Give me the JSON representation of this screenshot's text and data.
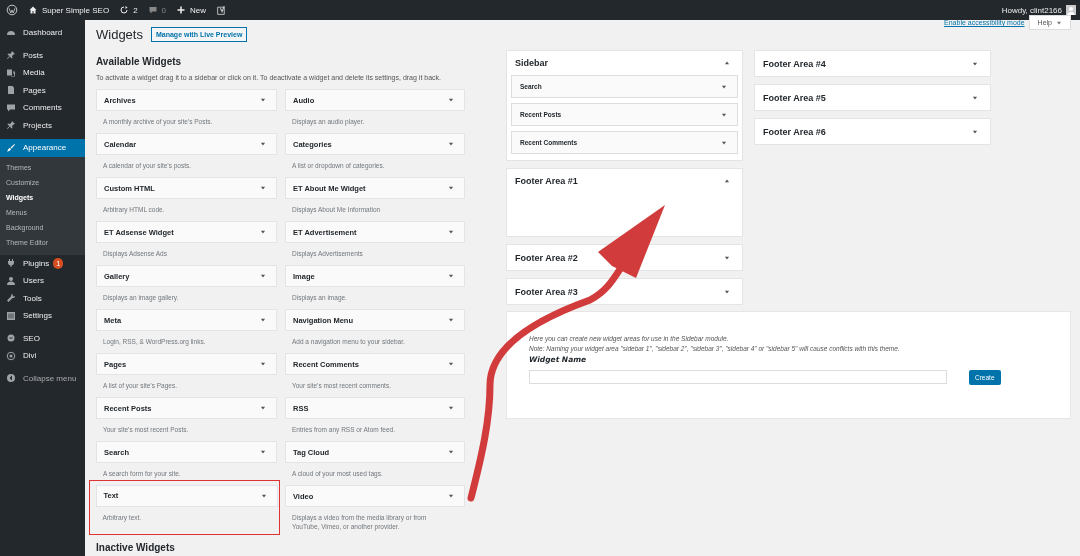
{
  "admin_bar": {
    "site": "Super Simple SEO",
    "updates": "2",
    "comments": "0",
    "new": "New",
    "greeting": "Howdy, clint2166"
  },
  "screen_meta": {
    "accessibility_link": "Enable accessibility mode",
    "help": "Help"
  },
  "sidebar": {
    "groups": [
      [
        {
          "label": "Dashboard",
          "selected": false
        }
      ],
      [
        {
          "label": "Posts",
          "selected": false
        },
        {
          "label": "Media",
          "selected": false
        },
        {
          "label": "Pages",
          "selected": false
        },
        {
          "label": "Comments",
          "selected": false
        },
        {
          "label": "Projects",
          "selected": false
        }
      ],
      [
        {
          "label": "Appearance",
          "selected": true,
          "children": [
            {
              "label": "Themes",
              "selected": false
            },
            {
              "label": "Customize",
              "selected": false
            },
            {
              "label": "Widgets",
              "selected": true
            },
            {
              "label": "Menus",
              "selected": false
            },
            {
              "label": "Background",
              "selected": false
            },
            {
              "label": "Theme Editor",
              "selected": false
            }
          ]
        },
        {
          "label": "Plugins",
          "selected": false,
          "badge": "1"
        },
        {
          "label": "Users",
          "selected": false
        },
        {
          "label": "Tools",
          "selected": false
        },
        {
          "label": "Settings",
          "selected": false
        }
      ],
      [
        {
          "label": "SEO",
          "selected": false
        },
        {
          "label": "Divi",
          "selected": false
        }
      ]
    ],
    "collapse": "Collapse menu"
  },
  "page": {
    "title": "Widgets",
    "preview_button": "Manage with Live Preview"
  },
  "available": {
    "heading": "Available Widgets",
    "description": "To activate a widget drag it to a sidebar or click on it. To deactivate a widget and delete its settings, drag it back.",
    "widgets": [
      {
        "title": "Archives",
        "description": "A monthly archive of your site’s Posts.",
        "highlighted": false
      },
      {
        "title": "Audio",
        "description": "Displays an audio player.",
        "highlighted": false
      },
      {
        "title": "Calendar",
        "description": "A calendar of your site’s posts.",
        "highlighted": false
      },
      {
        "title": "Categories",
        "description": "A list or dropdown of categories.",
        "highlighted": false
      },
      {
        "title": "Custom HTML",
        "description": "Arbitrary HTML code.",
        "highlighted": false
      },
      {
        "title": "ET About Me Widget",
        "description": "Displays About Me Information",
        "highlighted": false
      },
      {
        "title": "ET Adsense Widget",
        "description": "Displays Adsense Ads",
        "highlighted": false
      },
      {
        "title": "ET Advertisement",
        "description": "Displays Advertisements",
        "highlighted": false
      },
      {
        "title": "Gallery",
        "description": "Displays an image gallery.",
        "highlighted": false
      },
      {
        "title": "Image",
        "description": "Displays an image.",
        "highlighted": false
      },
      {
        "title": "Meta",
        "description": "Login, RSS, & WordPress.org links.",
        "highlighted": false
      },
      {
        "title": "Navigation Menu",
        "description": "Add a navigation menu to your sidebar.",
        "highlighted": false
      },
      {
        "title": "Pages",
        "description": "A list of your site’s Pages.",
        "highlighted": false
      },
      {
        "title": "Recent Comments",
        "description": "Your site’s most recent comments.",
        "highlighted": false
      },
      {
        "title": "Recent Posts",
        "description": "Your site’s most recent Posts.",
        "highlighted": false
      },
      {
        "title": "RSS",
        "description": "Entries from any RSS or Atom feed.",
        "highlighted": false
      },
      {
        "title": "Search",
        "description": "A search form for your site.",
        "highlighted": false
      },
      {
        "title": "Tag Cloud",
        "description": "A cloud of your most used tags.",
        "highlighted": false
      },
      {
        "title": "Text",
        "description": "Arbitrary text.",
        "highlighted": true
      },
      {
        "title": "Video",
        "description": "Displays a video from the media library or from YouTube, Vimeo, or another provider.",
        "highlighted": false
      }
    ]
  },
  "widget_areas": {
    "columns": [
      [
        {
          "title": "Sidebar",
          "expanded": true,
          "widgets": [
            {
              "title": "Search"
            },
            {
              "title": "Recent Posts"
            },
            {
              "title": "Recent Comments"
            }
          ]
        },
        {
          "title": "Footer Area #1",
          "expanded": true
        },
        {
          "title": "Footer Area #2",
          "expanded": false
        },
        {
          "title": "Footer Area #3",
          "expanded": false
        }
      ],
      [
        {
          "title": "Footer Area #4",
          "expanded": false
        },
        {
          "title": "Footer Area #5",
          "expanded": false
        },
        {
          "title": "Footer Area #6",
          "expanded": false
        }
      ]
    ]
  },
  "area_creator": {
    "notes": [
      "Here you can create new widget areas for use in the Sidebar module.",
      "Note: Naming your widget area \"sidebar 1\", \"sidebar 2\", \"sidebar 3\", \"sidebar 4\" or \"sidebar 5\" will cause conflicts with this theme."
    ],
    "label": "Widget Name",
    "button": "Create"
  },
  "inactive": {
    "heading": "Inactive Widgets"
  }
}
